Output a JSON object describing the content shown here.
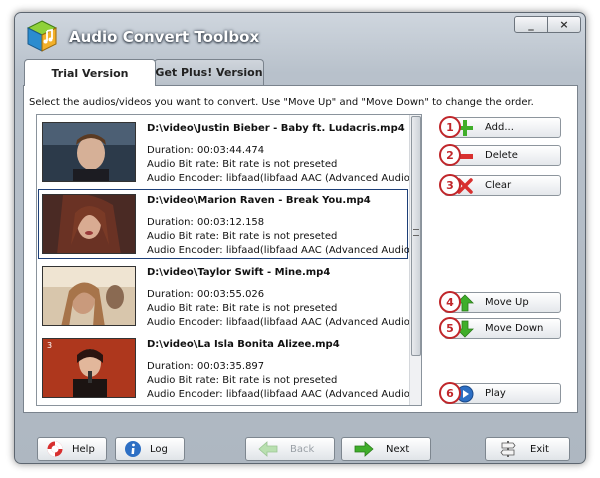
{
  "window": {
    "title": "Audio Convert Toolbox",
    "min_label": "_",
    "close_label": "×"
  },
  "tabs": [
    {
      "label": "Trial Version",
      "active": true
    },
    {
      "label": "Get Plus! Version",
      "active": false
    }
  ],
  "instruction": "Select the audios/videos you want to convert. Use \"Move Up\" and \"Move Down\" to change the order.",
  "files": [
    {
      "name": "D:\\video\\Justin Bieber - Baby ft. Ludacris.mp4",
      "duration": "Duration: 00:03:44.474",
      "bitrate": "Audio Bit rate: Bit rate is not preseted",
      "encoder": "Audio Encoder: libfaad(libfaad AAC (Advanced Audio C...",
      "selected": false
    },
    {
      "name": "D:\\video\\Marion Raven - Break You.mp4",
      "duration": "Duration: 00:03:12.158",
      "bitrate": "Audio Bit rate: Bit rate is not preseted",
      "encoder": "Audio Encoder: libfaad(libfaad AAC (Advanced Audio C...",
      "selected": true
    },
    {
      "name": "D:\\video\\Taylor Swift - Mine.mp4",
      "duration": "Duration: 00:03:55.026",
      "bitrate": "Audio Bit rate: Bit rate is not preseted",
      "encoder": "Audio Encoder: libfaad(libfaad AAC (Advanced Audio C...",
      "selected": false
    },
    {
      "name": "D:\\video\\La Isla Bonita Alizee.mp4",
      "duration": "Duration: 00:03:35.897",
      "bitrate": "Audio Bit rate: Bit rate is not preseted",
      "encoder": "Audio Encoder: libfaad(libfaad AAC (Advanced Audio C...",
      "selected": false
    }
  ],
  "thumb_overlay": "3",
  "side_buttons": [
    {
      "badge": "1",
      "label": "Add...",
      "icon": "plus-icon"
    },
    {
      "badge": "2",
      "label": "Delete",
      "icon": "minus-icon"
    },
    {
      "badge": "3",
      "label": "Clear",
      "icon": "x-icon"
    },
    {
      "badge": "4",
      "label": "Move Up",
      "icon": "arrow-up-icon"
    },
    {
      "badge": "5",
      "label": "Move Down",
      "icon": "arrow-down-icon"
    },
    {
      "badge": "6",
      "label": "Play",
      "icon": "play-icon"
    }
  ],
  "bottom_buttons": {
    "help": "Help",
    "log": "Log",
    "back": "Back",
    "next": "Next",
    "exit": "Exit"
  },
  "colors": {
    "accent_green": "#3fae2a",
    "accent_red": "#d8302f",
    "badge_red": "#c0262a",
    "selection_border": "#1d3f78"
  }
}
